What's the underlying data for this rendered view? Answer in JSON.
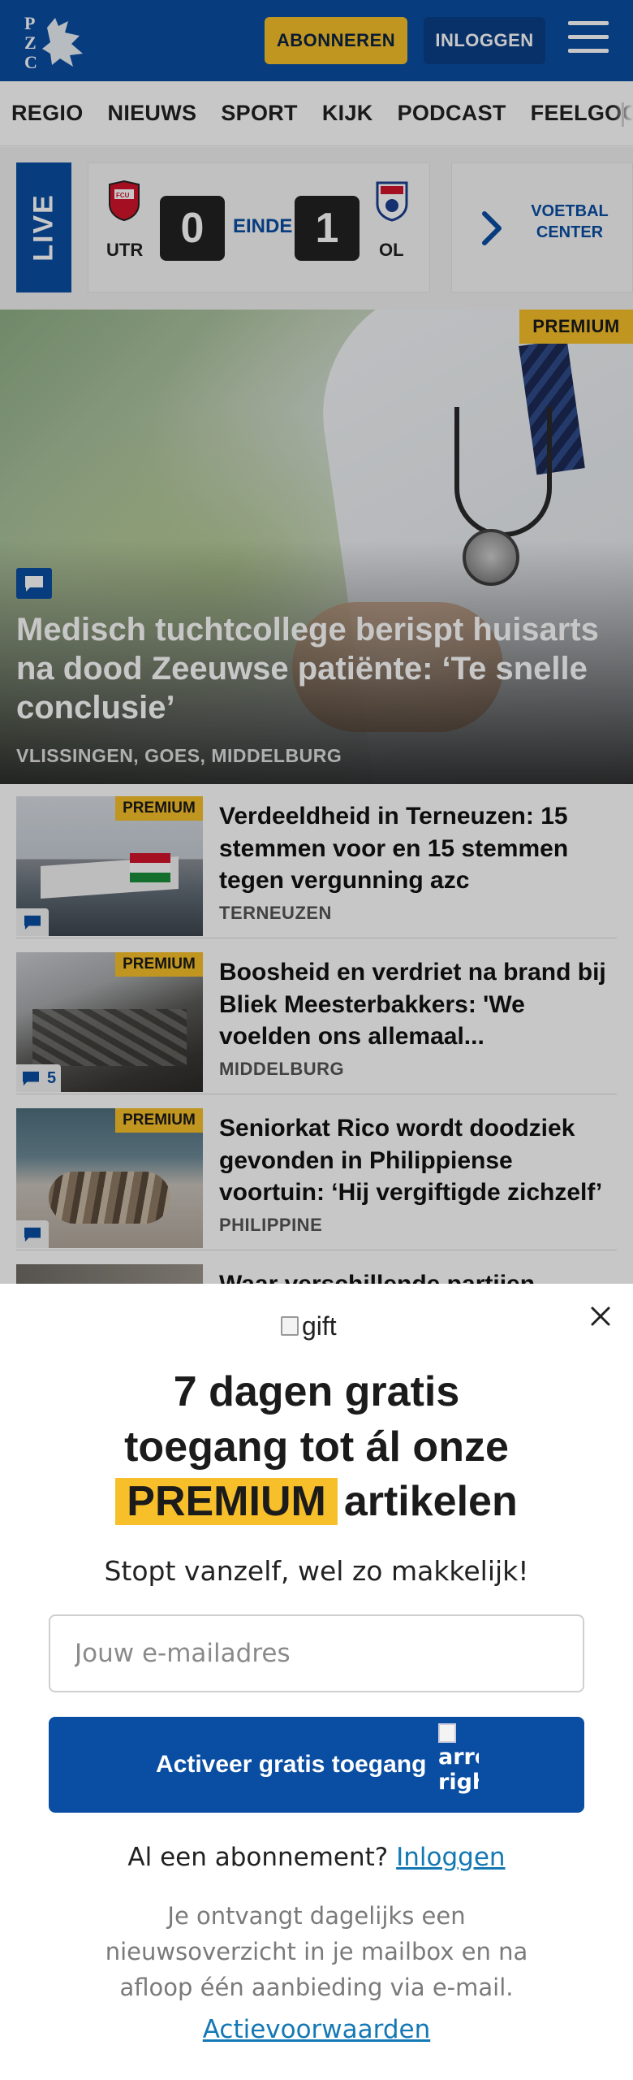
{
  "header": {
    "logo_text": "PZC",
    "subscribe_label": "ABONNEREN",
    "login_label": "INLOGGEN",
    "brand_color": "#0a4ea3",
    "accent_color": "#f7c02b"
  },
  "nav": {
    "items": [
      "REGIO",
      "NIEUWS",
      "SPORT",
      "KIJK",
      "PODCAST",
      "FEELGOOD"
    ]
  },
  "live": {
    "tag": "LIVE",
    "home_team": "UTR",
    "away_team": "OL",
    "home_score": "0",
    "away_score": "1",
    "status": "EINDE",
    "voetbal_center": "VOETBAL CENTER"
  },
  "hero": {
    "badge": "PREMIUM",
    "title": "Medisch tuchtcollege berispt huisarts na dood Zeeuwse patiënte: ‘Te snelle conclusie’",
    "location": "VLISSINGEN, GOES, MIDDELBURG"
  },
  "articles": [
    {
      "badge": "PREMIUM",
      "title": "Verdeeldheid in Terneuzen: 15 stemmen voor en 15 stemmen tegen vergunning azc",
      "location": "TERNEUZEN",
      "comments": ""
    },
    {
      "badge": "PREMIUM",
      "title": "Boosheid en verdriet na brand bij Bliek Meesterbakkers: 'We voelden ons allemaal...",
      "location": "MIDDELBURG",
      "comments": "5"
    },
    {
      "badge": "PREMIUM",
      "title": "Seniorkat Rico wordt doodziek gevonden in Philippiense voortuin: ‘Hij vergiftigde zichzelf’",
      "location": "PHILIPPINE",
      "comments": ""
    },
    {
      "title": "Waar verschillende partijen"
    }
  ],
  "modal": {
    "gift_alt": "gift",
    "title_line1": "7 dagen gratis",
    "title_line2": "toegang tot ál onze",
    "title_highlight": "PREMIUM",
    "title_line3_rest": "artikelen",
    "subtitle": "Stopt vanzelf, wel zo makkelijk!",
    "email_placeholder": "Jouw e-mailadres",
    "cta_label": "Activeer gratis toegang",
    "cta_arrow_alt_1": "arro",
    "cta_arrow_alt_2": "righ",
    "have_sub_text": "Al een abonnement?",
    "have_sub_link": "Inloggen",
    "info_text": "Je ontvangt dagelijks een nieuwsoverzicht in je mailbox en na afloop één aanbieding via e-mail.",
    "terms_link": "Actievoorwaarden"
  }
}
